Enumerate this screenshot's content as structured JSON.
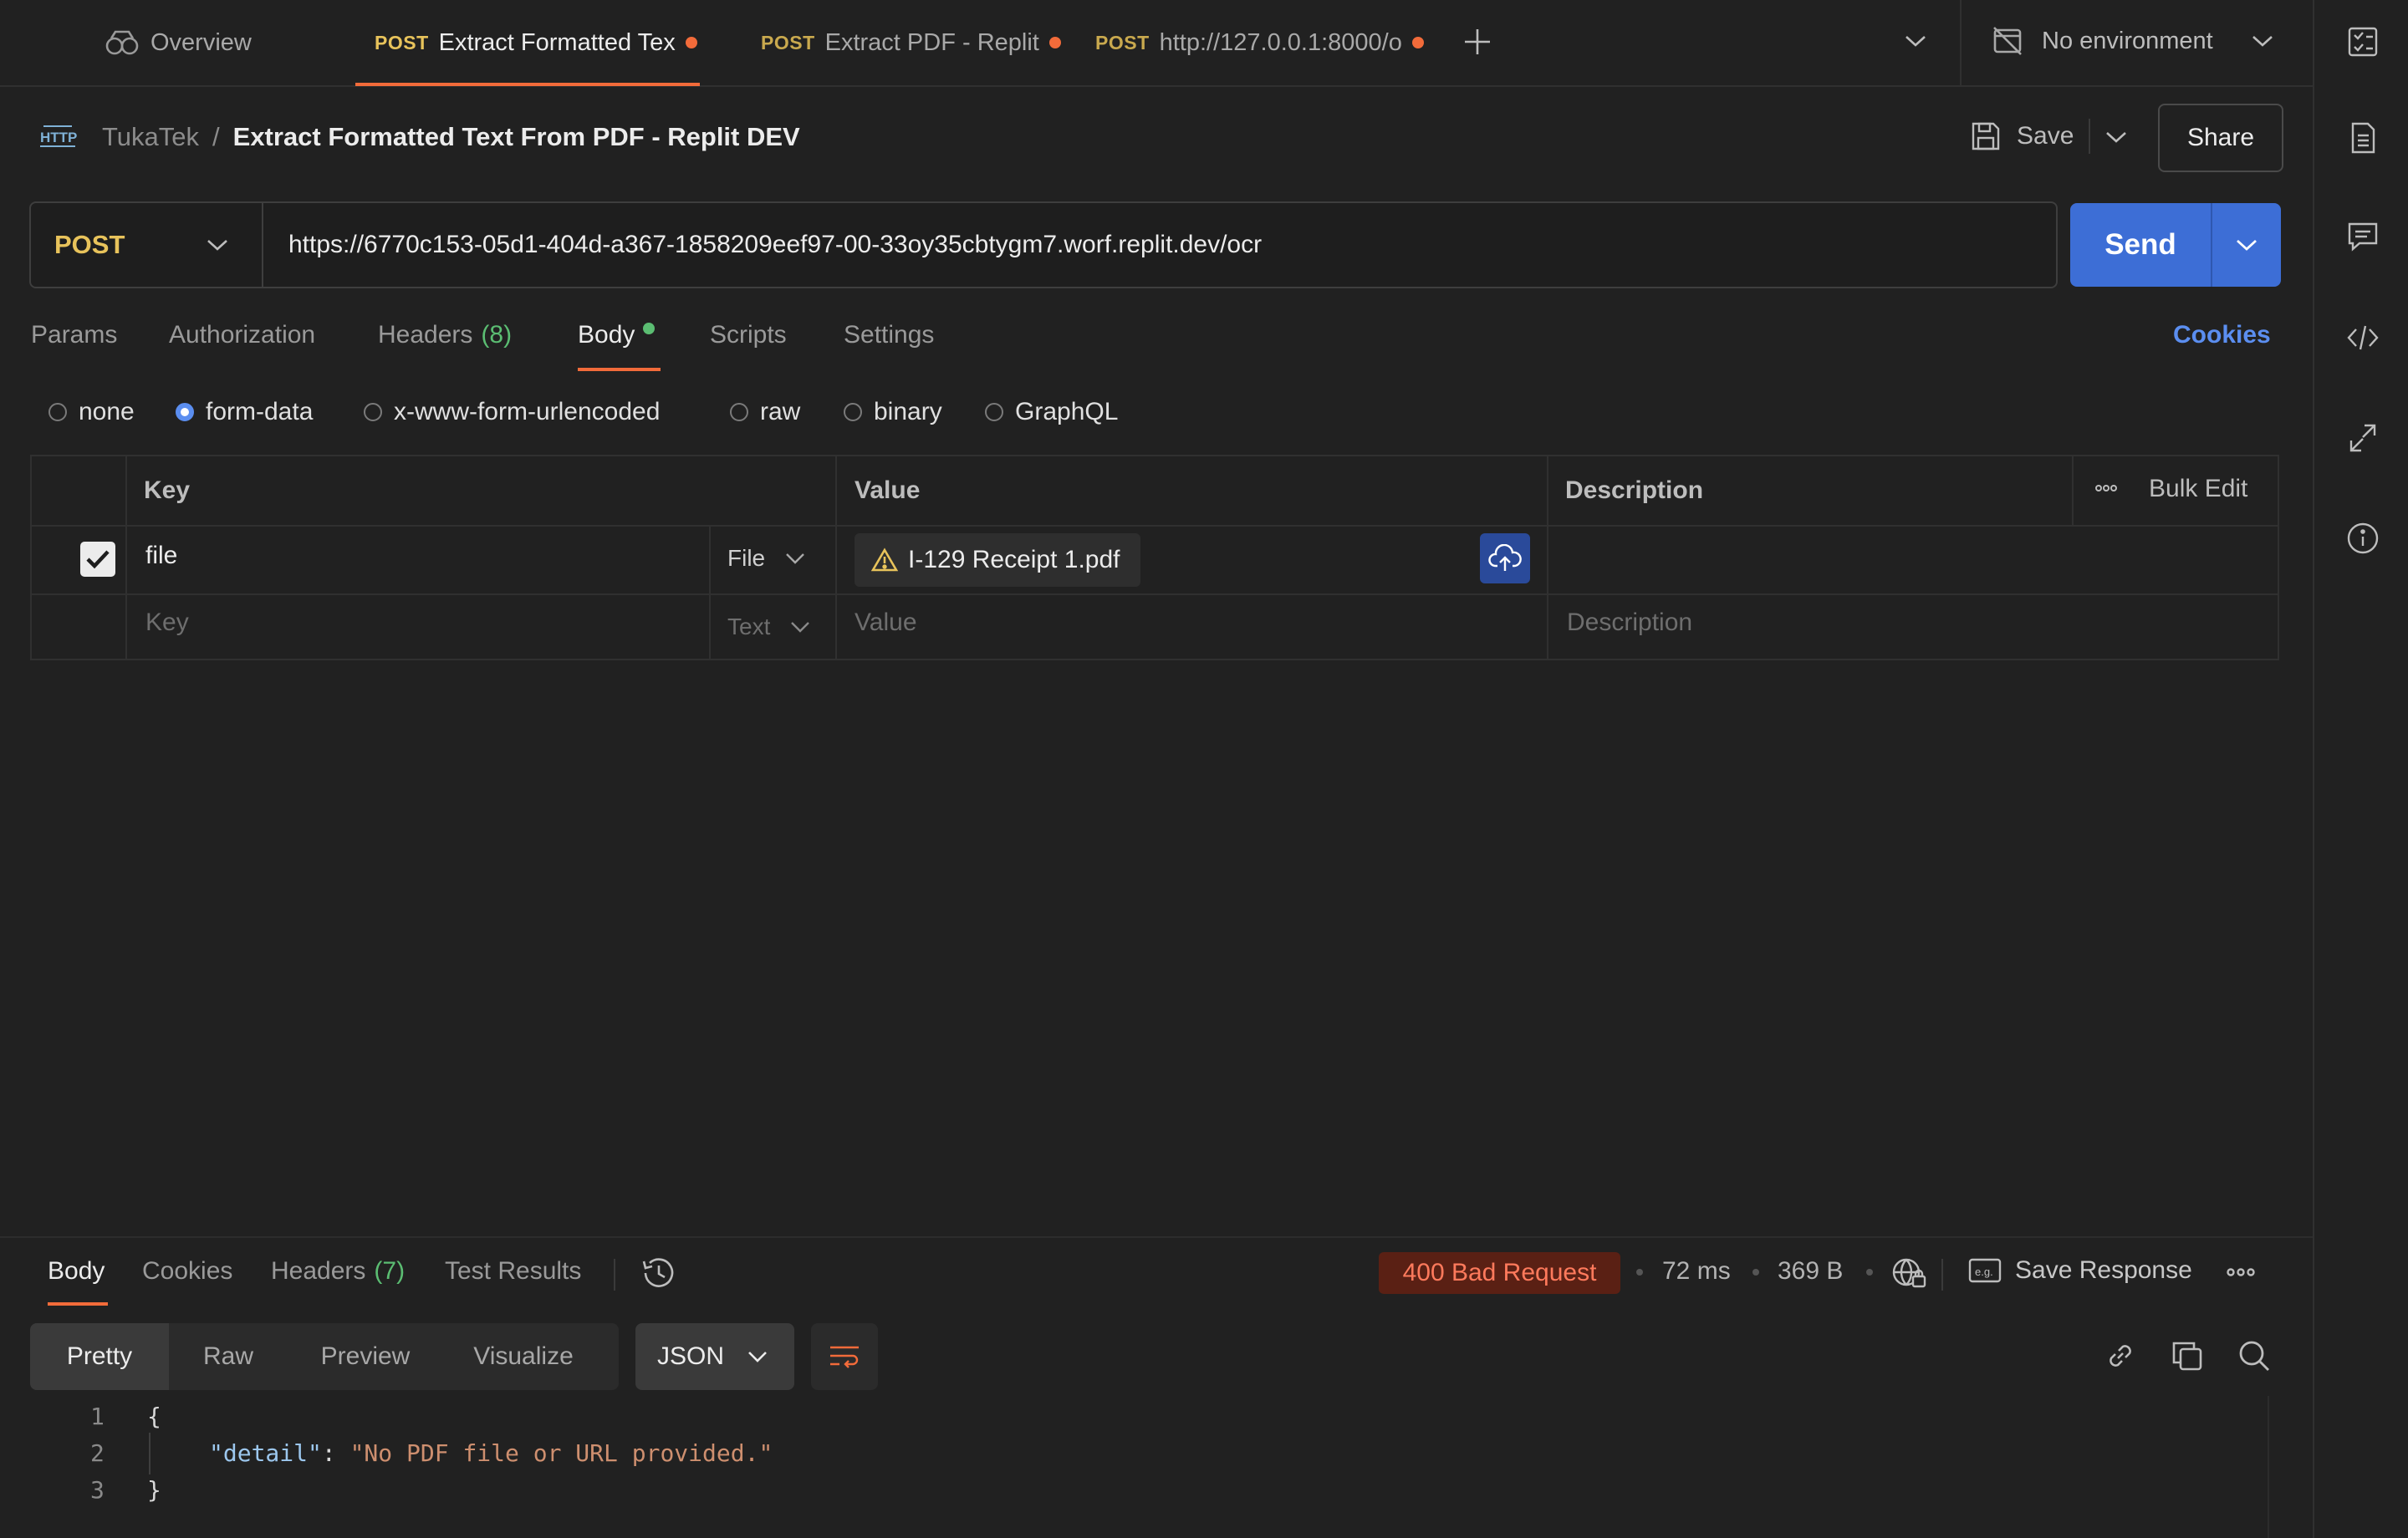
{
  "tabs": [
    {
      "method": "",
      "label": "Overview",
      "active": false
    },
    {
      "method": "POST",
      "label": "Extract Formatted Tex",
      "active": true,
      "unsaved": true
    },
    {
      "method": "POST",
      "label": "Extract PDF - Replit",
      "active": false,
      "unsaved": true
    },
    {
      "method": "POST",
      "label": "http://127.0.0.1:8000/o",
      "active": false,
      "unsaved": true
    }
  ],
  "environment": {
    "label": "No environment"
  },
  "breadcrumb": {
    "collection": "TukaTek",
    "separator": "/",
    "title": "Extract Formatted Text From PDF - Replit DEV"
  },
  "header_actions": {
    "save_label": "Save",
    "share_label": "Share"
  },
  "request": {
    "method": "POST",
    "url": "https://6770c153-05d1-404d-a367-1858209eef97-00-33oy35cbtygm7.worf.replit.dev/ocr",
    "send_label": "Send"
  },
  "request_tabs": {
    "params": "Params",
    "authorization": "Authorization",
    "headers": "Headers",
    "headers_count": "(8)",
    "body": "Body",
    "scripts": "Scripts",
    "settings": "Settings",
    "cookies": "Cookies"
  },
  "body_types": [
    "none",
    "form-data",
    "x-www-form-urlencoded",
    "raw",
    "binary",
    "GraphQL"
  ],
  "body_type_selected": "form-data",
  "form_table": {
    "headers": {
      "key": "Key",
      "value": "Value",
      "description": "Description",
      "bulk_edit": "Bulk Edit"
    },
    "rows": [
      {
        "checked": true,
        "key": "file",
        "type": "File",
        "value": "I-129 Receipt 1.pdf",
        "description": ""
      }
    ],
    "placeholder_row": {
      "key": "Key",
      "type": "Text",
      "value": "Value",
      "description": "Description"
    }
  },
  "response": {
    "tabs": {
      "body": "Body",
      "cookies": "Cookies",
      "headers": "Headers",
      "headers_count": "(7)",
      "test_results": "Test Results"
    },
    "status": "400 Bad Request",
    "time": "72 ms",
    "size": "369 B",
    "save_response": "Save Response",
    "views": [
      "Pretty",
      "Raw",
      "Preview",
      "Visualize"
    ],
    "format": "JSON",
    "code_lines": [
      {
        "n": "1",
        "text": "{"
      },
      {
        "n": "2",
        "key": "\"detail\"",
        "colon": ": ",
        "value": "\"No PDF file or URL provided.\""
      },
      {
        "n": "3",
        "text": "}"
      }
    ]
  },
  "colors": {
    "accent": "#f26b3a",
    "send": "#3d6ed6",
    "method": "#e8c35b",
    "status_error": "#ff7a5c",
    "success_count": "#5bbd72",
    "link": "#5b8ef0"
  }
}
